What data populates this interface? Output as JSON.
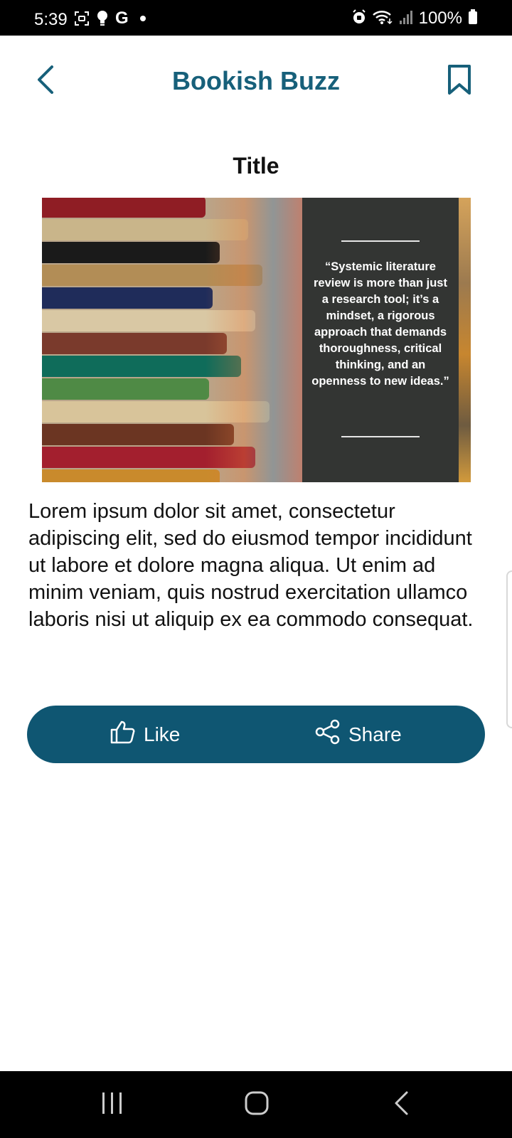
{
  "status_bar": {
    "time": "5:39",
    "google_letter": "G",
    "battery_text": "100%",
    "icons": [
      "screenshot-icon",
      "bulb-icon",
      "google-icon",
      "dot-icon",
      "alarm-icon",
      "wifi-icon",
      "signal-icon",
      "battery-icon"
    ]
  },
  "app_bar": {
    "title": "Bookish Buzz",
    "back_icon": "chevron-left-icon",
    "bookmark_icon": "bookmark-icon"
  },
  "post": {
    "title": "Title",
    "image_quote": "“Systemic literature review is more than just a research tool; it’s a mindset, a rigorous approach that demands thoroughness, critical thinking, and an openness to new ideas.”",
    "body": "Lorem ipsum dolor sit amet, consectetur adipiscing elit, sed do eiusmod tempor incididunt ut labore et dolore magna aliqua. Ut enim ad minim veniam, quis nostrud exercitation ullamco laboris nisi ut aliquip ex ea commodo consequat."
  },
  "actions": {
    "like_label": "Like",
    "share_label": "Share",
    "like_icon": "thumbs-up-icon",
    "share_icon": "share-icon"
  },
  "colors": {
    "accent": "#17607a",
    "action_bar": "#0f5672",
    "quote_panel": "#333533"
  },
  "nav_bar": {
    "icons": [
      "recents-icon",
      "home-icon",
      "back-icon"
    ]
  }
}
